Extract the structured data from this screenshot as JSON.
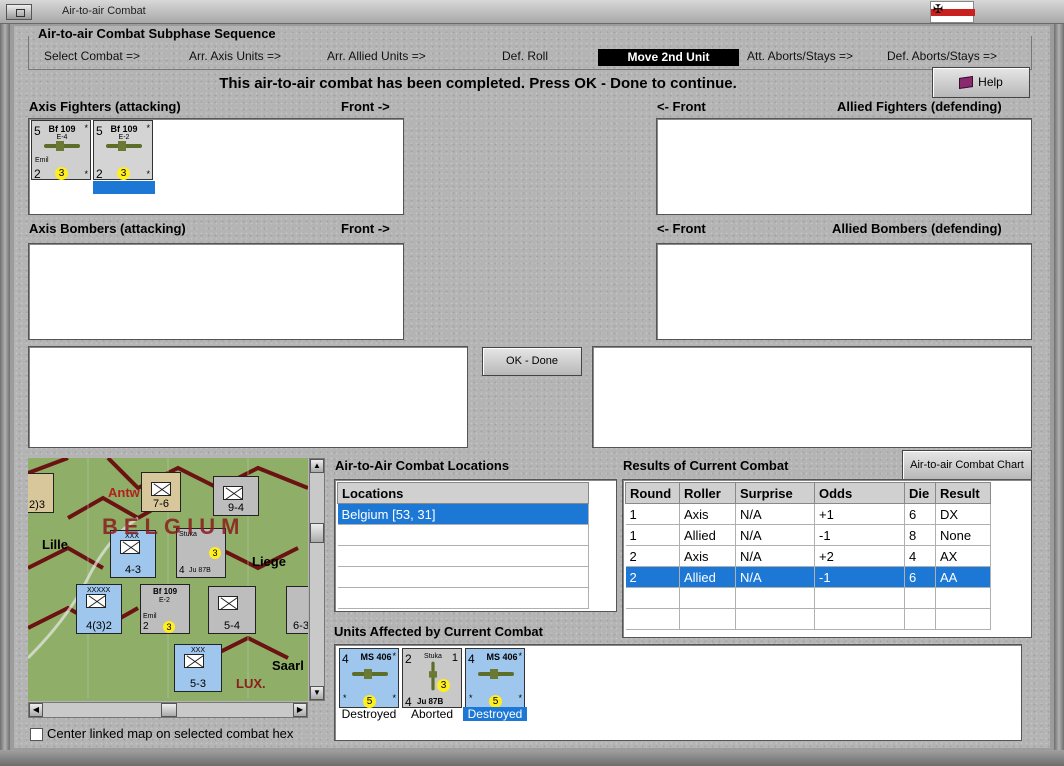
{
  "window": {
    "title": "Air-to-air Combat"
  },
  "subphase": {
    "title": "Air-to-air Combat Subphase Sequence",
    "steps": [
      "Select Combat =>",
      "Arr. Axis Units =>",
      "Arr. Allied Units =>",
      "Def. Roll",
      "Move 2nd Unit",
      "Att. Aborts/Stays =>",
      "Def. Aborts/Stays =>"
    ],
    "active_step": "Move 2nd Unit"
  },
  "message": "This air-to-air combat has been completed.  Press OK - Done to continue.",
  "help_label": "Help",
  "axis_fighters": {
    "label": "Axis Fighters (attacking)",
    "front": "Front ->",
    "units": [
      {
        "top_left": "5",
        "name": "Bf 109",
        "variant": "E-4",
        "pilot": "Emil",
        "bottom_left": "2",
        "coin": "3"
      },
      {
        "top_left": "5",
        "name": "Bf 109",
        "variant": "E-2",
        "pilot": "",
        "bottom_left": "2",
        "coin": "3"
      }
    ]
  },
  "allied_fighters": {
    "label": "Allied Fighters (defending)",
    "front": "<- Front"
  },
  "axis_bombers": {
    "label": "Axis Bombers (attacking)",
    "front": "Front ->"
  },
  "allied_bombers": {
    "label": "Allied Bombers (defending)",
    "front": "<- Front"
  },
  "ok_button": "OK - Done",
  "map": {
    "labels": [
      "Antw",
      "Lille",
      "Liege",
      "Saarl",
      "LUX.",
      "BELGIUM"
    ],
    "hex_values": [
      "7-6",
      "9-4",
      "4-3",
      "5-4",
      "4(3)2",
      "5-3",
      "6-3",
      "2)3"
    ],
    "stuka": {
      "name": "Stuka",
      "model": "Ju 87B",
      "left": "4",
      "coin": "3"
    },
    "bf": {
      "name": "Bf 109",
      "variant": "E-2",
      "pilot": "Emil",
      "left": "2",
      "coin": "3"
    },
    "small_labels": [
      "XXX",
      "XXXXX",
      "XX"
    ]
  },
  "center_map_label": "Center linked map on selected combat hex",
  "locations": {
    "title": "Air-to-Air Combat Locations",
    "header": "Locations",
    "rows": [
      "Belgium [53, 31]"
    ]
  },
  "results": {
    "title": "Results of Current Combat",
    "chart_button": "Air-to-air Combat Chart",
    "columns": [
      "Round",
      "Roller",
      "Surprise",
      "Odds",
      "Die",
      "Result"
    ],
    "rows": [
      [
        "1",
        "Axis",
        "N/A",
        "+1",
        "6",
        "DX"
      ],
      [
        "1",
        "Allied",
        "N/A",
        "-1",
        "8",
        "None"
      ],
      [
        "2",
        "Axis",
        "N/A",
        "+2",
        "4",
        "AX"
      ],
      [
        "2",
        "Allied",
        "N/A",
        "-1",
        "6",
        "AA"
      ]
    ],
    "selected_row": 3
  },
  "affected": {
    "title": "Units Affected by Current Combat",
    "units": [
      {
        "top_left": "4",
        "name": "MS 406",
        "coin": "5",
        "caption": "Destroyed"
      },
      {
        "top_left": "2",
        "name": "Stuka",
        "model": "Ju 87B",
        "bottom_left": "4",
        "top_right": "1",
        "coin": "3",
        "caption": "Aborted"
      },
      {
        "top_left": "4",
        "name": "MS 406",
        "coin": "5",
        "caption": "Destroyed"
      }
    ]
  },
  "colors": {
    "selection": "#1c78d4",
    "coin": "#ffee20",
    "allied_counter": "#9fc6ec",
    "border": "#8b1d1d"
  }
}
